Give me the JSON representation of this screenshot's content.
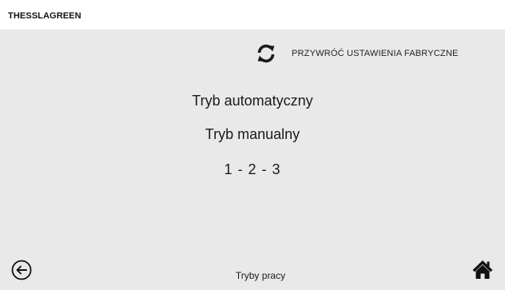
{
  "header": {
    "brand": "THESSLAGREEN"
  },
  "reset": {
    "label": "PRZYWRÓĆ USTAWIENIA FABRYCZNE",
    "icon": "refresh-icon"
  },
  "modes": [
    {
      "label": "Tryb automatyczny"
    },
    {
      "label": "Tryb manualny"
    },
    {
      "label": "1 - 2 - 3"
    }
  ],
  "footer": {
    "title": "Tryby pracy",
    "back_icon": "back-arrow-icon",
    "home_icon": "home-icon"
  },
  "colors": {
    "panel_background": "#e9e9e9",
    "text": "#1a1a1a"
  }
}
